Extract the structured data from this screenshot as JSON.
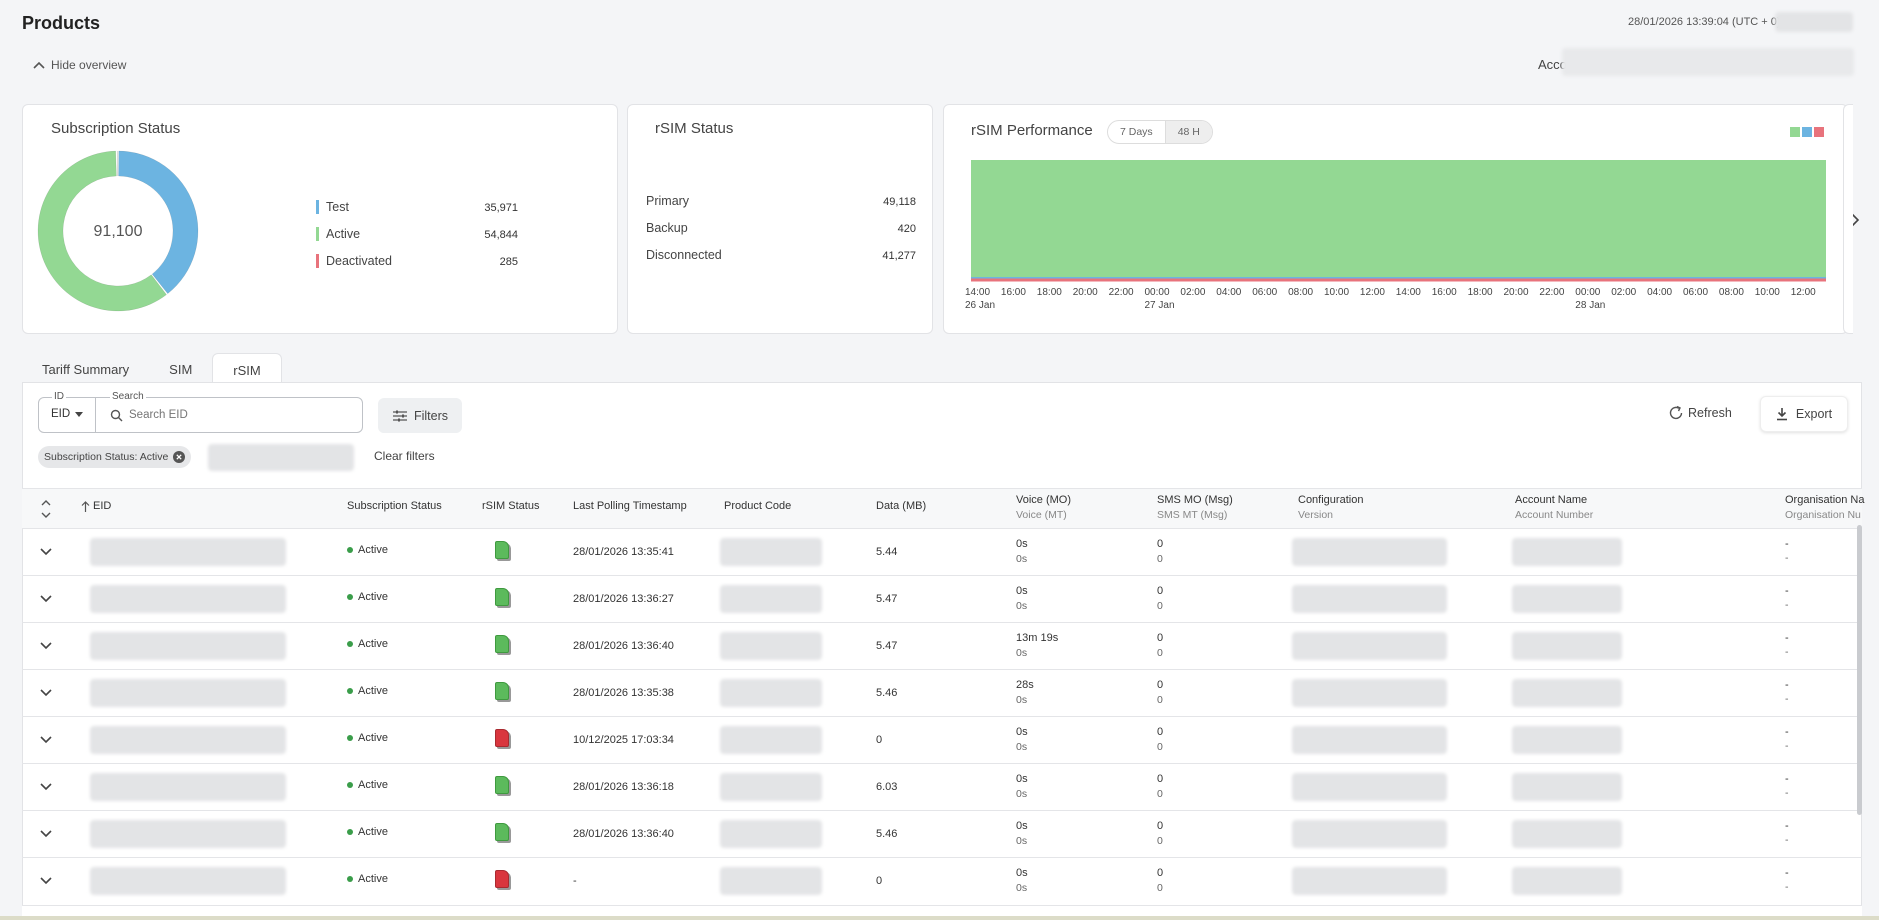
{
  "header": {
    "title": "Products",
    "datetime": "28/01/2026 13:39:04 (UTC + 0)",
    "hide_overview": "Hide overview",
    "account_label": "Account:"
  },
  "subscription_status": {
    "title": "Subscription Status",
    "total": "91,100",
    "legend": [
      {
        "label": "Test",
        "value": "35,971",
        "color": "#6cb4e1"
      },
      {
        "label": "Active",
        "value": "54,844",
        "color": "#93d893"
      },
      {
        "label": "Deactivated",
        "value": "285",
        "color": "#e8737c"
      }
    ]
  },
  "rsim_status": {
    "title": "rSIM Status",
    "rows": [
      {
        "label": "Primary",
        "value": "49,118"
      },
      {
        "label": "Backup",
        "value": "420"
      },
      {
        "label": "Disconnected",
        "value": "41,277"
      }
    ]
  },
  "rsim_performance": {
    "title": "rSIM Performance",
    "toggle": [
      "7 Days",
      "48 H"
    ],
    "active_toggle": "48 H",
    "colors": [
      "#93d893",
      "#6cb4e1",
      "#e8737c"
    ],
    "time_ticks": [
      "14:00",
      "16:00",
      "18:00",
      "20:00",
      "22:00",
      "00:00",
      "02:00",
      "04:00",
      "06:00",
      "08:00",
      "10:00",
      "12:00",
      "14:00",
      "16:00",
      "18:00",
      "20:00",
      "22:00",
      "00:00",
      "02:00",
      "04:00",
      "06:00",
      "08:00",
      "10:00",
      "12:00"
    ],
    "date_labels": [
      "26 Jan",
      "27 Jan",
      "28 Jan"
    ]
  },
  "tabs": [
    "Tariff Summary",
    "SIM",
    "rSIM"
  ],
  "active_tab": "rSIM",
  "toolbar": {
    "id_label": "ID",
    "id_value": "EID",
    "search_label": "Search",
    "search_placeholder": "Search EID",
    "filters_label": "Filters",
    "refresh_label": "Refresh",
    "export_label": "Export",
    "chip_label": "Subscription Status: Active",
    "clear_filters": "Clear filters"
  },
  "columns": [
    {
      "top": "EID",
      "bottom": ""
    },
    {
      "top": "Subscription Status",
      "bottom": ""
    },
    {
      "top": "rSIM Status",
      "bottom": ""
    },
    {
      "top": "Last Polling Timestamp",
      "bottom": ""
    },
    {
      "top": "Product Code",
      "bottom": ""
    },
    {
      "top": "Data (MB)",
      "bottom": ""
    },
    {
      "top": "Voice (MO)",
      "bottom": "Voice (MT)"
    },
    {
      "top": "SMS MO (Msg)",
      "bottom": "SMS MT (Msg)"
    },
    {
      "top": "Configuration",
      "bottom": "Version"
    },
    {
      "top": "Account Name",
      "bottom": "Account Number"
    },
    {
      "top": "Organisation Na",
      "bottom": "Organisation Nu"
    }
  ],
  "rows": [
    {
      "status": "Active",
      "rsim": "green",
      "timestamp": "28/01/2026 13:35:41",
      "data": "5.44",
      "voice_mo": "0s",
      "voice_mt": "0s",
      "sms_mo": "0",
      "sms_mt": "0",
      "org1": "-",
      "org2": "-"
    },
    {
      "status": "Active",
      "rsim": "green",
      "timestamp": "28/01/2026 13:36:27",
      "data": "5.47",
      "voice_mo": "0s",
      "voice_mt": "0s",
      "sms_mo": "0",
      "sms_mt": "0",
      "org1": "-",
      "org2": "-"
    },
    {
      "status": "Active",
      "rsim": "green",
      "timestamp": "28/01/2026 13:36:40",
      "data": "5.47",
      "voice_mo": "13m 19s",
      "voice_mt": "0s",
      "sms_mo": "0",
      "sms_mt": "0",
      "org1": "-",
      "org2": "-"
    },
    {
      "status": "Active",
      "rsim": "green",
      "timestamp": "28/01/2026 13:35:38",
      "data": "5.46",
      "voice_mo": "28s",
      "voice_mt": "0s",
      "sms_mo": "0",
      "sms_mt": "0",
      "org1": "-",
      "org2": "-"
    },
    {
      "status": "Active",
      "rsim": "red",
      "timestamp": "10/12/2025 17:03:34",
      "data": "0",
      "voice_mo": "0s",
      "voice_mt": "0s",
      "sms_mo": "0",
      "sms_mt": "0",
      "org1": "-",
      "org2": "-"
    },
    {
      "status": "Active",
      "rsim": "green",
      "timestamp": "28/01/2026 13:36:18",
      "data": "6.03",
      "voice_mo": "0s",
      "voice_mt": "0s",
      "sms_mo": "0",
      "sms_mt": "0",
      "org1": "-",
      "org2": "-"
    },
    {
      "status": "Active",
      "rsim": "green",
      "timestamp": "28/01/2026 13:36:40",
      "data": "5.46",
      "voice_mo": "0s",
      "voice_mt": "0s",
      "sms_mo": "0",
      "sms_mt": "0",
      "org1": "-",
      "org2": "-"
    },
    {
      "status": "Active",
      "rsim": "red",
      "timestamp": "-",
      "data": "0",
      "voice_mo": "0s",
      "voice_mt": "0s",
      "sms_mo": "0",
      "sms_mt": "0",
      "org1": "-",
      "org2": "-"
    }
  ]
}
